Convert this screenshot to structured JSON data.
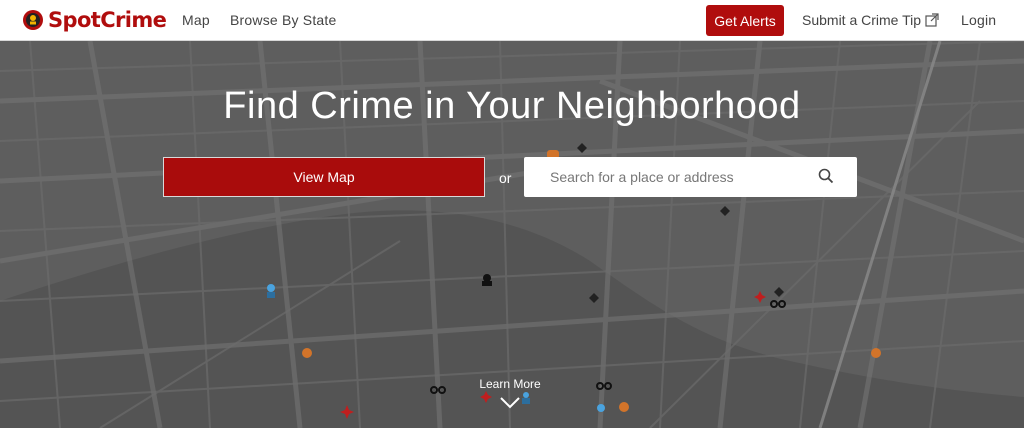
{
  "header": {
    "logo_text": "SpotCrime",
    "nav": {
      "map": "Map",
      "browse": "Browse By State"
    },
    "alerts_button": "Get Alerts",
    "submit_tip": "Submit a Crime Tip",
    "login": "Login"
  },
  "hero": {
    "title": "Find Crime in Your Neighborhood",
    "view_map_button": "View Map",
    "or_text": "or",
    "search": {
      "placeholder": "Search for a place or address",
      "value": ""
    },
    "learn_more": "Learn More"
  },
  "colors": {
    "brand_red": "#b00d0d",
    "map_bg": "#5e5e5e"
  },
  "icons": {
    "logo": "spotcrime-logo-icon",
    "external": "external-link-icon",
    "search": "search-icon",
    "chevron": "chevron-down-icon"
  },
  "map_markers": [
    {
      "type": "burglary"
    },
    {
      "type": "theft"
    },
    {
      "type": "theft"
    },
    {
      "type": "theft"
    },
    {
      "type": "arrest"
    },
    {
      "type": "assault"
    },
    {
      "type": "robbery"
    },
    {
      "type": "vandalism"
    },
    {
      "type": "other"
    }
  ]
}
